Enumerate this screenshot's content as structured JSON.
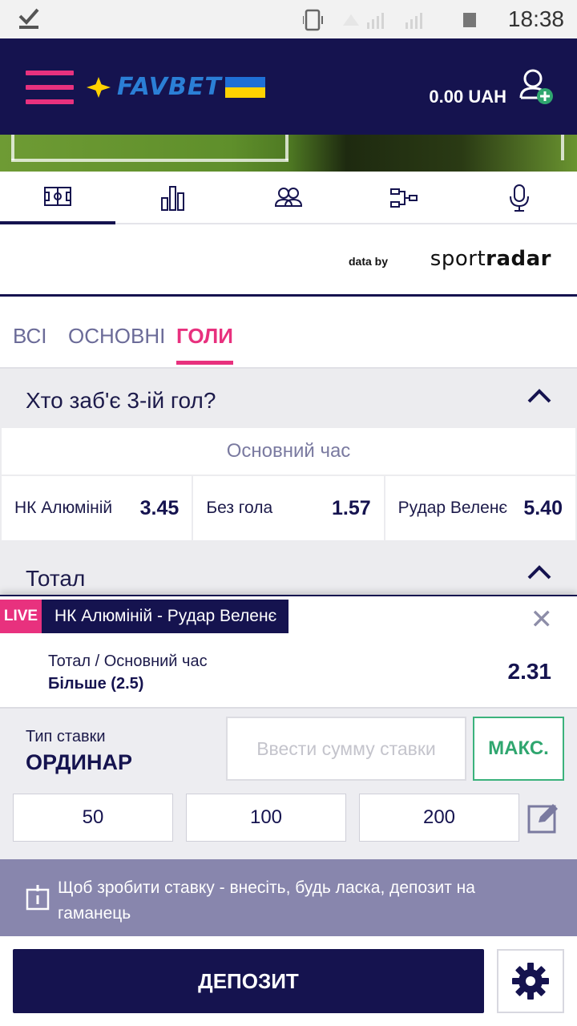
{
  "status_bar": {
    "time": "18:38"
  },
  "header": {
    "logo_text": "FAVBET",
    "balance": "0.00 UAH"
  },
  "icon_tabs": [
    {
      "name": "field-icon",
      "active": true
    },
    {
      "name": "stats-icon",
      "active": false
    },
    {
      "name": "lineups-icon",
      "active": false
    },
    {
      "name": "bracket-icon",
      "active": false
    },
    {
      "name": "microphone-icon",
      "active": false
    }
  ],
  "sportradar": {
    "data_by": "data by",
    "brand_light": "sport",
    "brand_bold": "radar"
  },
  "market_tabs": [
    {
      "label": "ВСІ",
      "active": false
    },
    {
      "label": "ОСНОВНІ",
      "active": false
    },
    {
      "label": "ГОЛИ",
      "active": true
    }
  ],
  "market": {
    "title": "Хто заб'є 3-ій гол?",
    "period": "Основний час",
    "odds": [
      {
        "name": "НК Алюміній",
        "value": "3.45"
      },
      {
        "name": "Без гола",
        "value": "1.57"
      },
      {
        "name": "Рудар Веленє",
        "value": "5.40"
      }
    ]
  },
  "market2": {
    "title": "Тотал"
  },
  "betslip": {
    "live_label": "LIVE",
    "match": "НК Алюміній - Рудар Веленє",
    "market": "Тотал / Основний час",
    "outcome": "Більше (2.5)",
    "coefficient": "2.31"
  },
  "stake": {
    "bet_type_label": "Тип ставки",
    "bet_type_value": "ОРДИНАР",
    "input_placeholder": "Ввести сумму ставки",
    "max_label": "МАКС.",
    "quick_amounts": [
      "50",
      "100",
      "200"
    ]
  },
  "notice": {
    "text": "Щоб зробити ставку - внесіть, будь ласка, депозит на гаманець"
  },
  "bottom": {
    "deposit_label": "ДЕПОЗИТ"
  },
  "colors": {
    "navy": "#15134f",
    "pink": "#e8317e",
    "green": "#2fa66f",
    "notice_bg": "#8886ad"
  }
}
